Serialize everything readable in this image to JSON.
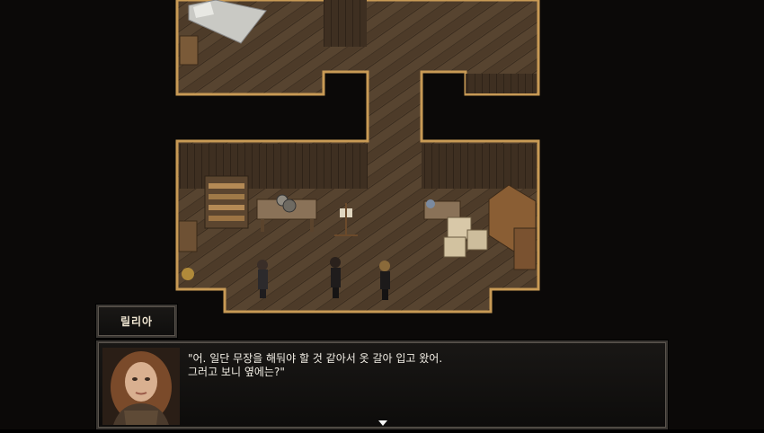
{
  "dialog": {
    "speaker": "릴리아",
    "line1": "\"어. 일단 무장을 해둬야 할 것 같아서 옷 갈아 입고 왔어.",
    "line2": "그러고 보니 옆에는?\""
  },
  "icons": {
    "advance": "triangle-down",
    "portrait": "lilia-portrait"
  },
  "colors": {
    "floor": "#5a4631",
    "wall_edge": "#c89a55",
    "dialog_bg": "#131110",
    "dialog_text": "#f3efe6"
  }
}
